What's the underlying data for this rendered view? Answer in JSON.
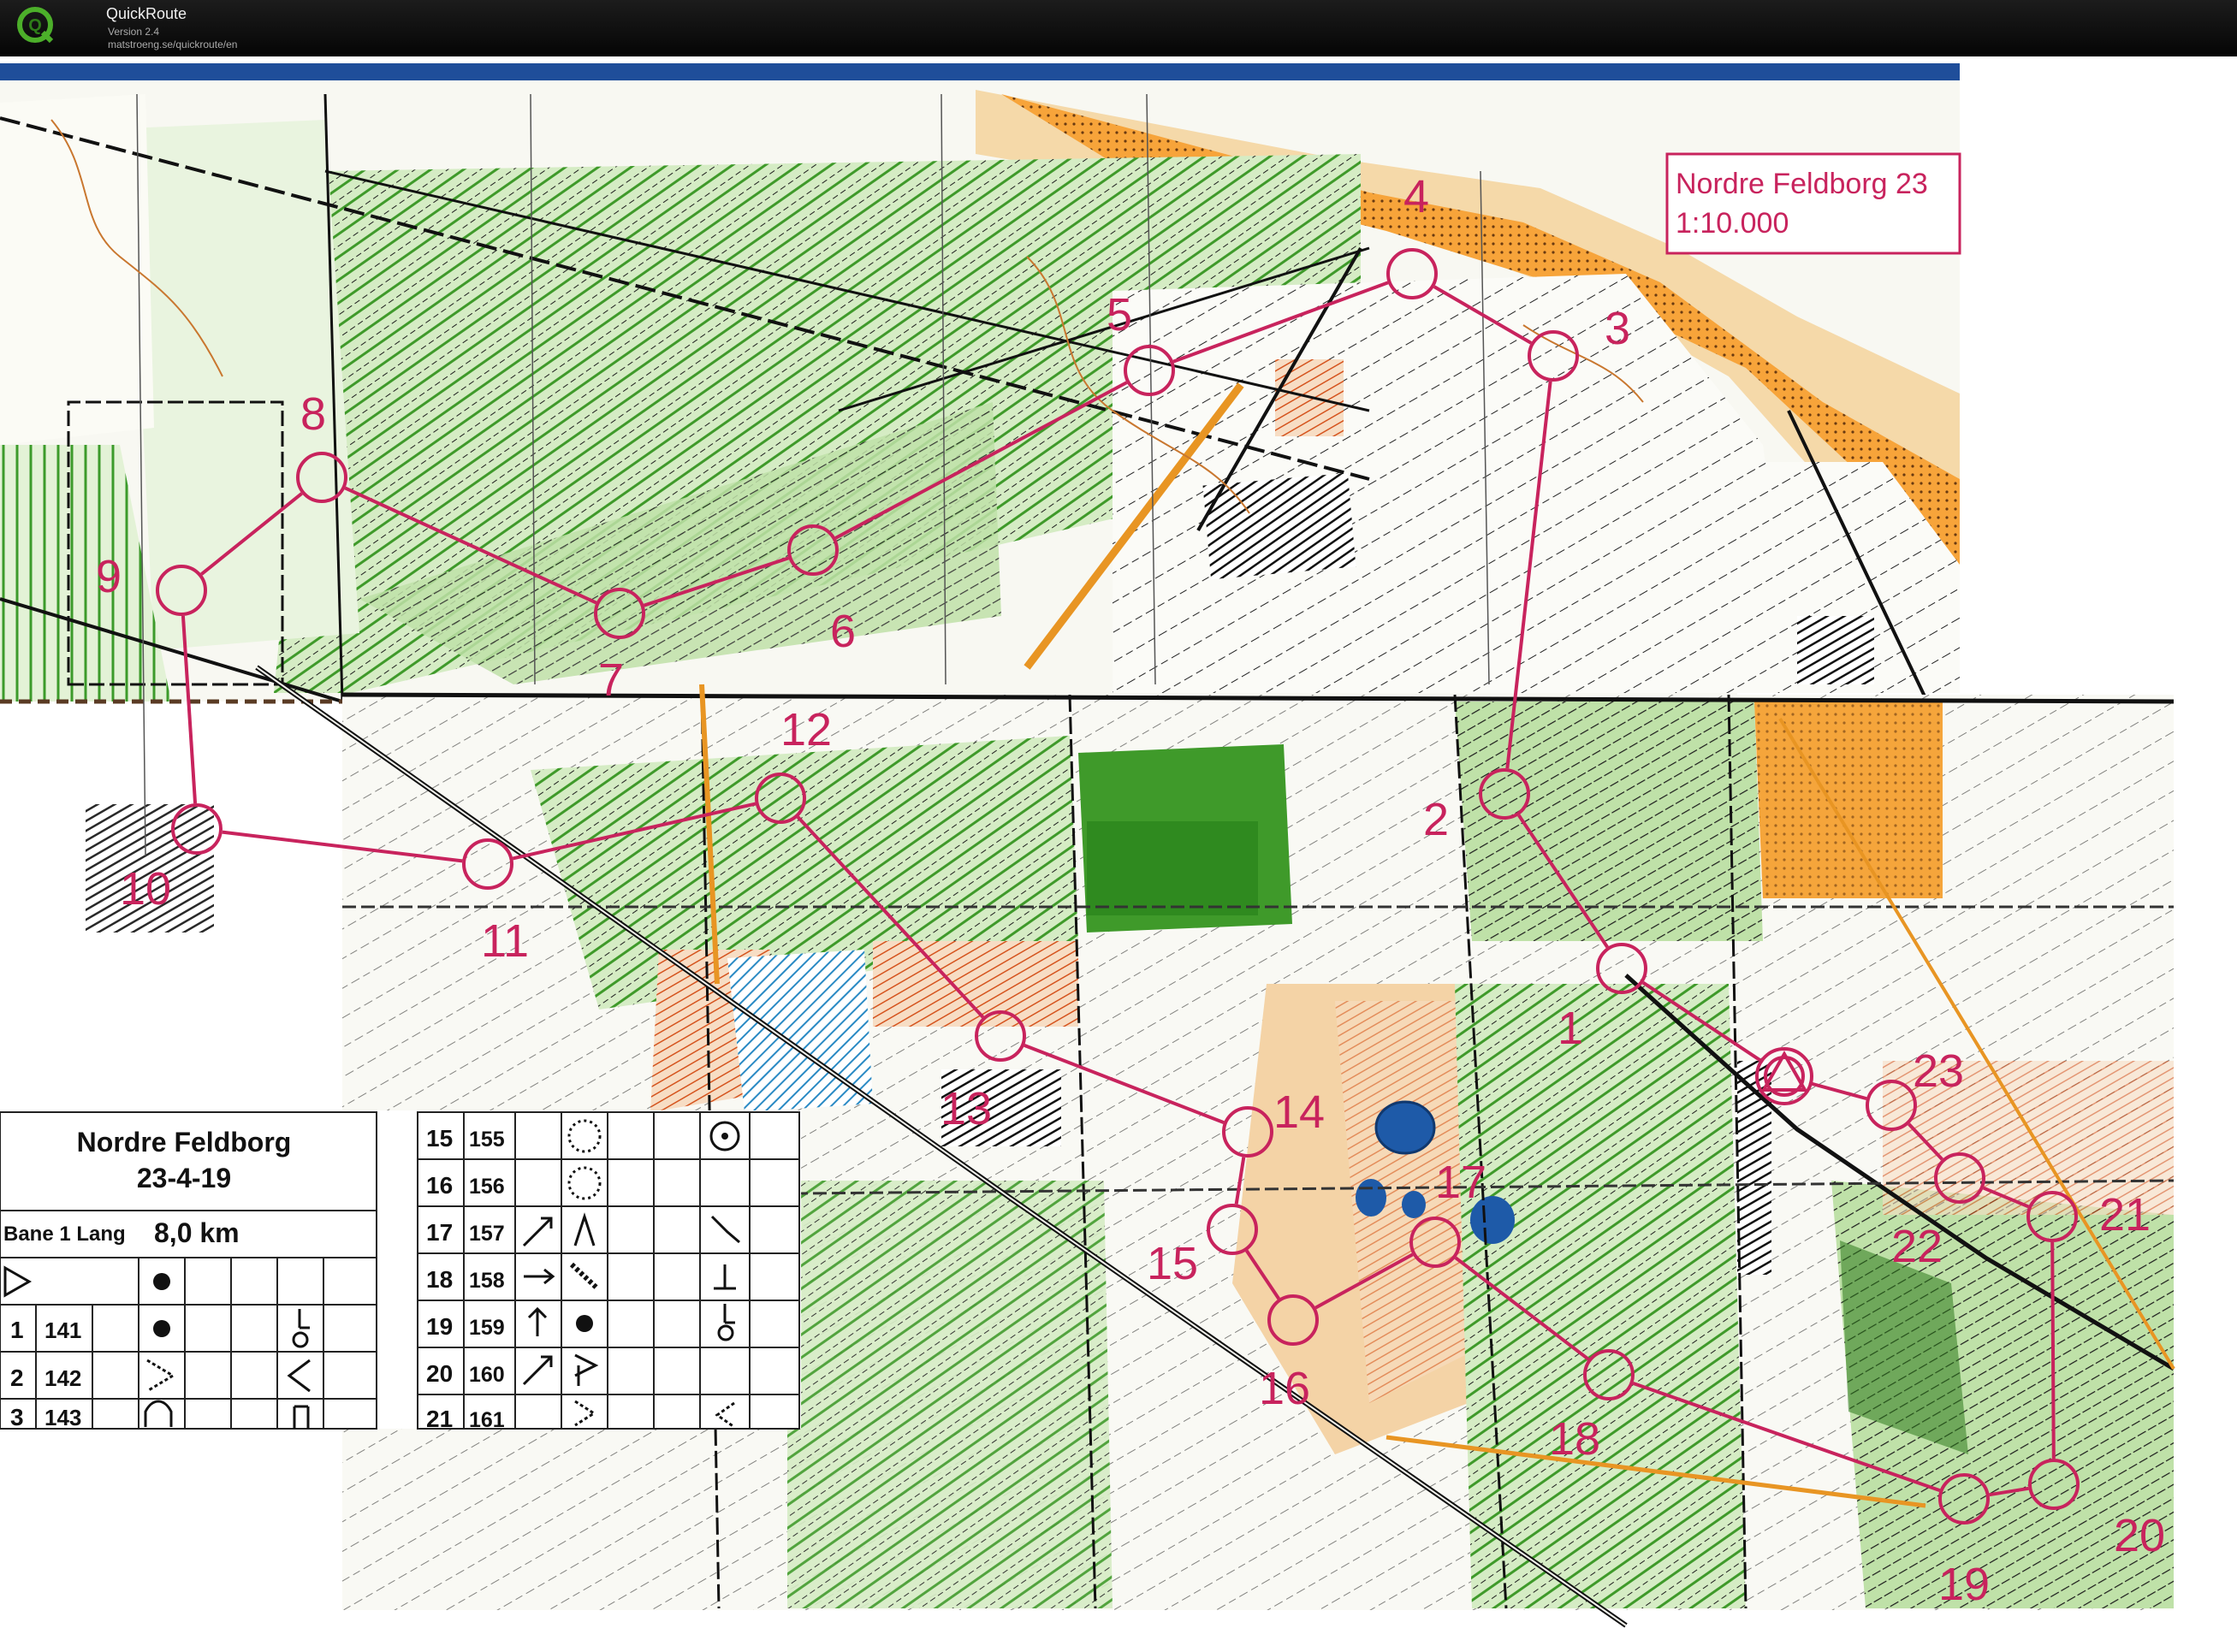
{
  "app": {
    "title": "QuickRoute",
    "version": "Version 2.4",
    "url": "matstroeng.se/quickroute/en",
    "logo_letter": "Q",
    "icon": "quickroute-logo-icon"
  },
  "map": {
    "title": "Nordre Feldborg 23",
    "scale": "1:10.000",
    "course_color": "#c8235d",
    "route_color": "#c8235d"
  },
  "controls": [
    {
      "label": "1"
    },
    {
      "label": "2"
    },
    {
      "label": "3"
    },
    {
      "label": "4"
    },
    {
      "label": "5"
    },
    {
      "label": "6"
    },
    {
      "label": "7"
    },
    {
      "label": "8"
    },
    {
      "label": "9"
    },
    {
      "label": "10"
    },
    {
      "label": "11"
    },
    {
      "label": "12"
    },
    {
      "label": "13"
    },
    {
      "label": "14"
    },
    {
      "label": "15"
    },
    {
      "label": "16"
    },
    {
      "label": "17"
    },
    {
      "label": "18"
    },
    {
      "label": "19"
    },
    {
      "label": "20"
    },
    {
      "label": "21"
    },
    {
      "label": "22"
    },
    {
      "label": "23"
    }
  ],
  "description_sheet": {
    "event": "Nordre Feldborg",
    "date": "23-4-19",
    "course": "Bane 1 Lang",
    "length": "8,0 km",
    "left_rows": [
      {
        "num": "1",
        "code": "141"
      },
      {
        "num": "2",
        "code": "142"
      },
      {
        "num": "3",
        "code": "143"
      }
    ],
    "right_rows": [
      {
        "num": "15",
        "code": "155"
      },
      {
        "num": "16",
        "code": "156"
      },
      {
        "num": "17",
        "code": "157"
      },
      {
        "num": "18",
        "code": "158"
      },
      {
        "num": "19",
        "code": "159"
      },
      {
        "num": "20",
        "code": "160"
      },
      {
        "num": "21",
        "code": "161"
      }
    ]
  }
}
